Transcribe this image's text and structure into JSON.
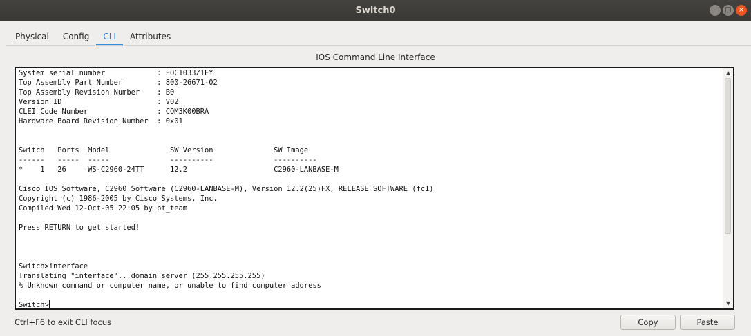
{
  "window": {
    "title": "Switch0",
    "controls": {
      "minimize": "–",
      "maximize": "□",
      "close": "×"
    }
  },
  "tabs": [
    {
      "label": "Physical",
      "active": false
    },
    {
      "label": "Config",
      "active": false
    },
    {
      "label": "CLI",
      "active": true
    },
    {
      "label": "Attributes",
      "active": false
    }
  ],
  "cli": {
    "heading": "IOS Command Line Interface",
    "lines": [
      "System serial number            : FOC1033Z1EY",
      "Top Assembly Part Number        : 800-26671-02",
      "Top Assembly Revision Number    : B0",
      "Version ID                      : V02",
      "CLEI Code Number                : COM3K00BRA",
      "Hardware Board Revision Number  : 0x01",
      "",
      "",
      "Switch   Ports  Model              SW Version              SW Image",
      "------   -----  -----              ----------              ----------",
      "*    1   26     WS-C2960-24TT      12.2                    C2960-LANBASE-M",
      "",
      "Cisco IOS Software, C2960 Software (C2960-LANBASE-M), Version 12.2(25)FX, RELEASE SOFTWARE (fc1)",
      "Copyright (c) 1986-2005 by Cisco Systems, Inc.",
      "Compiled Wed 12-Oct-05 22:05 by pt_team",
      "",
      "Press RETURN to get started!",
      "",
      "",
      "",
      "Switch>interface",
      "Translating \"interface\"...domain server (255.255.255.255)",
      "% Unknown command or computer name, or unable to find computer address",
      ""
    ],
    "prompt": "Switch>"
  },
  "footer": {
    "hint": "Ctrl+F6 to exit CLI focus",
    "copy_label": "Copy",
    "paste_label": "Paste"
  },
  "colors": {
    "accent": "#2b8ee0",
    "close_button": "#e95420",
    "titlebar": "#3d3c39"
  },
  "icons": {
    "scroll_up": "scroll-up-arrow-icon",
    "scroll_down": "scroll-down-arrow-icon"
  }
}
